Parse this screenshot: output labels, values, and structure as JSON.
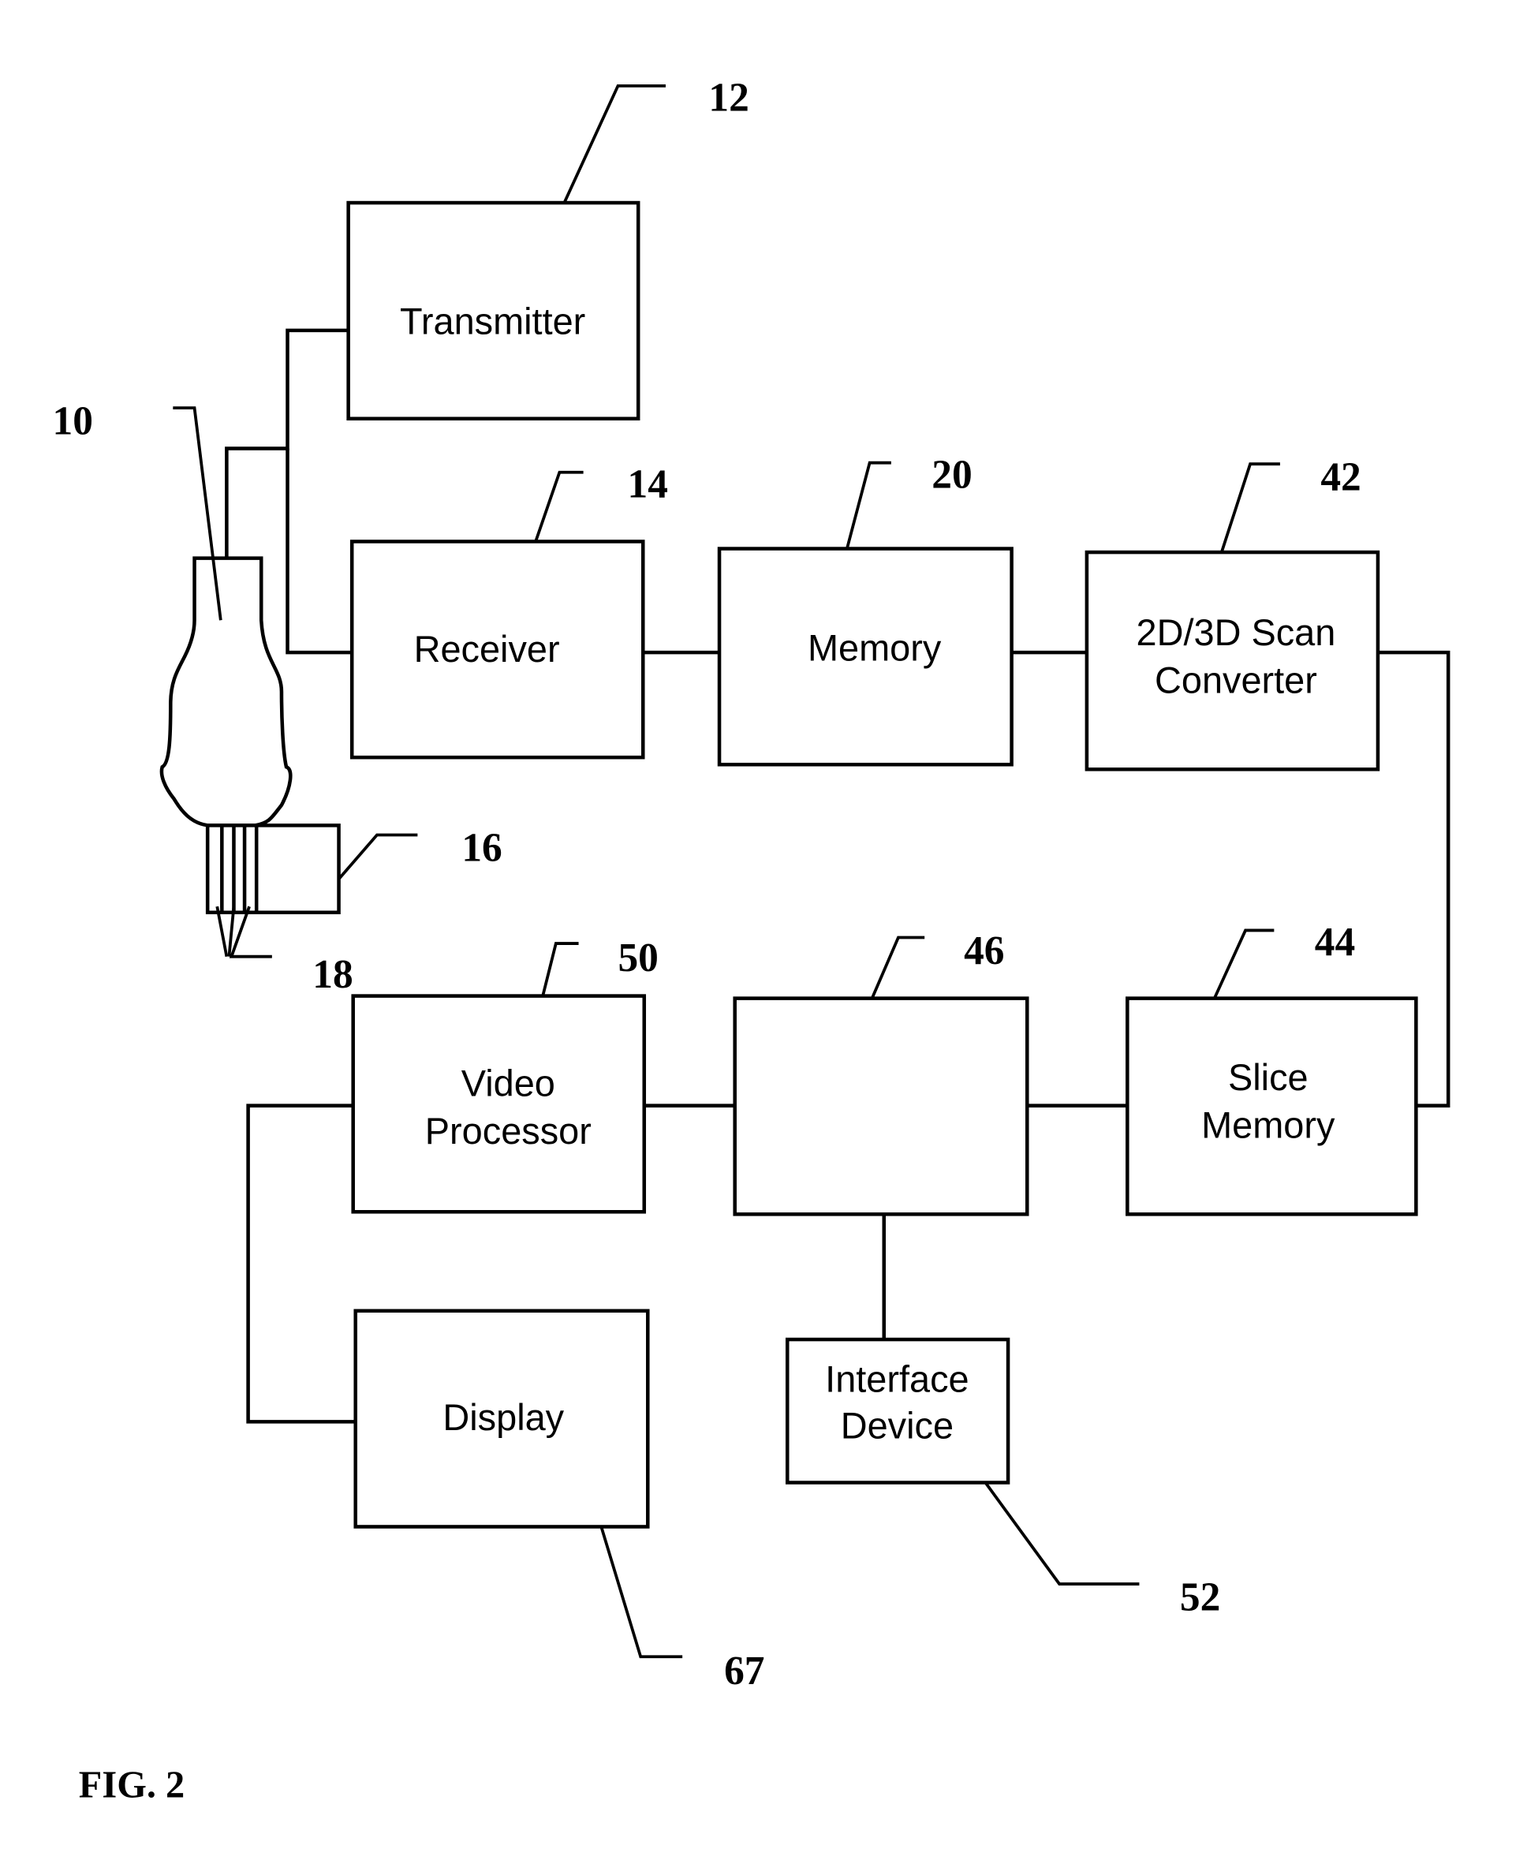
{
  "figure": {
    "caption": "FIG. 2"
  },
  "blocks": {
    "transmitter": {
      "label": [
        "Transmitter"
      ],
      "ref": "12"
    },
    "receiver": {
      "label": [
        "Receiver"
      ],
      "ref": "14"
    },
    "memory": {
      "label": [
        "Memory"
      ],
      "ref": "20"
    },
    "scan_converter": {
      "label": [
        "2D/3D Scan",
        "Converter"
      ],
      "ref": "42"
    },
    "slice_memory": {
      "label": [
        "Slice",
        "Memory"
      ],
      "ref": "44"
    },
    "block_46": {
      "label": [],
      "ref": "46"
    },
    "video_processor": {
      "label": [
        "Video",
        "Processor"
      ],
      "ref": "50"
    },
    "display": {
      "label": [
        "Display"
      ],
      "ref": "67"
    },
    "interface_device": {
      "label": [
        "Interface",
        "Device"
      ],
      "ref": "52"
    }
  },
  "probe": {
    "ref": "10"
  },
  "probe_element_block": {
    "ref": "16"
  },
  "probe_elements": {
    "ref": "18"
  },
  "colors": {
    "ink": "#000000",
    "paper": "#ffffff"
  }
}
